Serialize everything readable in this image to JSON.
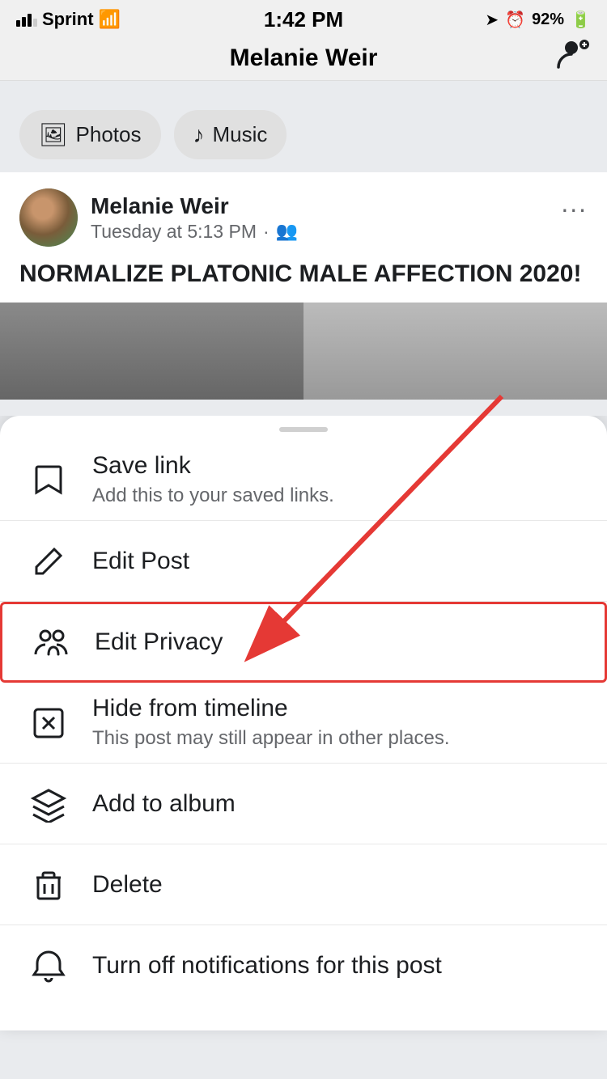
{
  "statusBar": {
    "carrier": "Sprint",
    "time": "1:42 PM",
    "battery": "92%"
  },
  "header": {
    "title": "Melanie Weir",
    "profileIconLabel": "profile-edit-icon"
  },
  "quickActions": [
    {
      "icon": "🖼",
      "label": "Photos"
    },
    {
      "icon": "♪",
      "label": "Music"
    }
  ],
  "post": {
    "username": "Melanie Weir",
    "timestamp": "Tuesday at 5:13 PM",
    "audience": "Friends",
    "text": "NORMALIZE PLATONIC MALE AFFECTION 2020!",
    "moreOptionsLabel": "..."
  },
  "bottomSheet": {
    "handleLabel": "sheet-handle",
    "menuItems": [
      {
        "id": "save-link",
        "icon": "bookmark",
        "title": "Save link",
        "subtitle": "Add this to your saved links."
      },
      {
        "id": "edit-post",
        "icon": "pencil",
        "title": "Edit Post",
        "subtitle": ""
      },
      {
        "id": "edit-privacy",
        "icon": "people",
        "title": "Edit Privacy",
        "subtitle": "",
        "highlighted": true
      },
      {
        "id": "hide-from-timeline",
        "icon": "x-square",
        "title": "Hide from timeline",
        "subtitle": "This post may still appear in other places."
      },
      {
        "id": "add-to-album",
        "icon": "layers",
        "title": "Add to album",
        "subtitle": ""
      },
      {
        "id": "delete",
        "icon": "trash",
        "title": "Delete",
        "subtitle": ""
      },
      {
        "id": "turn-off-notifications",
        "icon": "bell",
        "title": "Turn off notifications for this post",
        "subtitle": ""
      }
    ]
  },
  "annotation": {
    "arrowColor": "#e53935"
  }
}
